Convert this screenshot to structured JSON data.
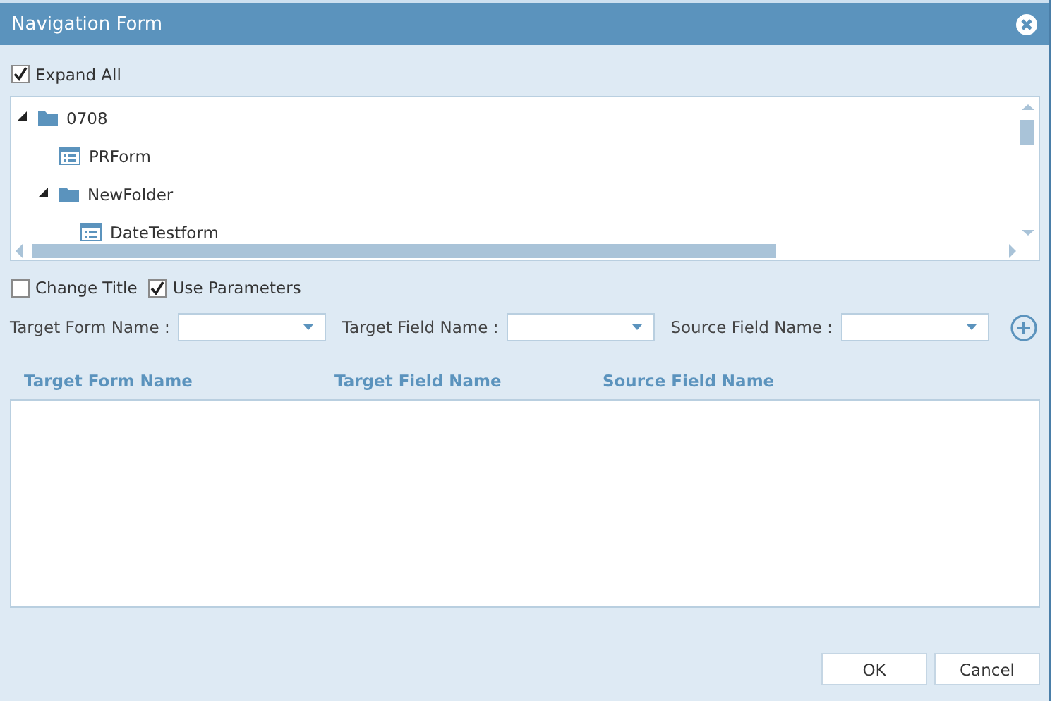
{
  "window": {
    "title": "Navigation Form"
  },
  "expand_all": {
    "label": "Expand All",
    "checked": true
  },
  "tree": [
    {
      "label": "0708",
      "kind": "folder",
      "expanded": true,
      "children": [
        {
          "label": "PRForm",
          "kind": "form"
        },
        {
          "label": "NewFolder",
          "kind": "folder",
          "expanded": true,
          "children": [
            {
              "label": "DateTestform",
              "kind": "form"
            }
          ]
        }
      ]
    }
  ],
  "options": [
    {
      "label": "Change Title",
      "checked": false
    },
    {
      "label": "Use Parameters",
      "checked": true
    }
  ],
  "fields": [
    {
      "label": "Target Form Name :"
    },
    {
      "label": "Target Field Name :"
    },
    {
      "label": "Source Field Name :"
    }
  ],
  "table": {
    "columns": [
      "Target Form Name",
      "Target Field Name",
      "Source Field Name"
    ]
  },
  "buttons": [
    "OK",
    "Cancel"
  ]
}
